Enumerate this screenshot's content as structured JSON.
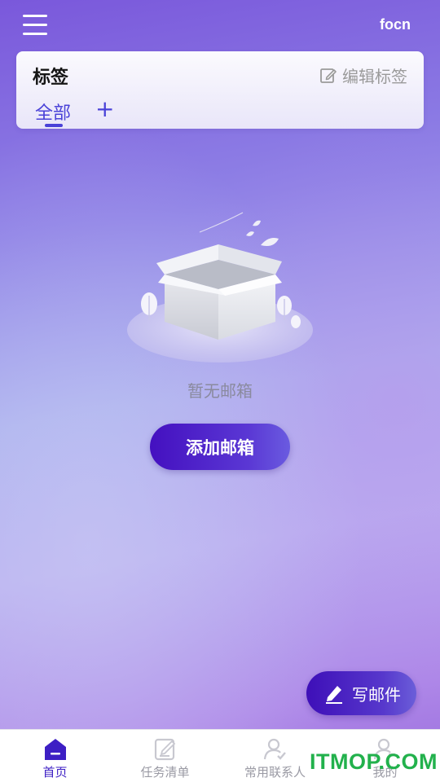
{
  "header": {
    "username": "focn"
  },
  "tag_card": {
    "title": "标签",
    "edit_label": "编辑标签",
    "tabs": [
      {
        "label": "全部",
        "active": true
      }
    ],
    "add_symbol": "+"
  },
  "empty_state": {
    "message": "暂无邮箱",
    "action_label": "添加邮箱"
  },
  "compose": {
    "label": "写邮件"
  },
  "bottom_nav": {
    "items": [
      {
        "label": "首页",
        "icon": "home-icon",
        "active": true
      },
      {
        "label": "任务清单",
        "icon": "task-list-icon",
        "active": false
      },
      {
        "label": "常用联系人",
        "icon": "contacts-icon",
        "active": false
      },
      {
        "label": "我的",
        "icon": "profile-icon",
        "active": false
      }
    ]
  },
  "watermark": {
    "text": "ITMOP.COM"
  },
  "colors": {
    "accent": "#4a42d8",
    "button_primary": "#4410c0",
    "watermark": "#22b14c"
  }
}
